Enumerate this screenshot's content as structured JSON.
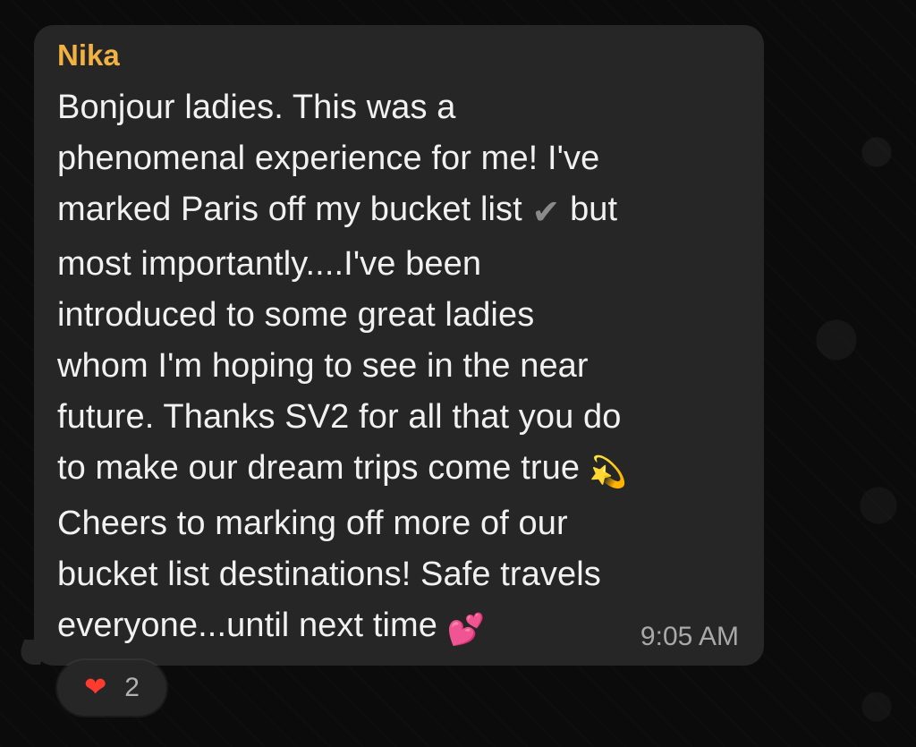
{
  "conversation": {
    "sender": "Nika",
    "message_lines": [
      "Bonjour ladies. This was a",
      "phenomenal experience for me! I've",
      "marked Paris off my bucket list ",
      "most importantly....I've been",
      "introduced to some great ladies",
      "whom I'm hoping to see in the near",
      "future. Thanks SV2 for all that you do",
      "to make our dream trips come true ",
      "Cheers to marking off more of our",
      "bucket list destinations! Safe travels",
      "everyone...until next time "
    ],
    "inline_texts": {
      "line_3_suffix": " but",
      "time": "9:05 AM"
    },
    "icons": {
      "checkmark": "checkmark-icon",
      "sparkle": "dizzy-sparkle-icon",
      "hearts": "pink-hearts-icon",
      "reaction": "red-heart-icon"
    },
    "reaction": {
      "count": "2"
    },
    "colors": {
      "background": "#0b0b0b",
      "bubble": "#262626",
      "sender": "#f2b143",
      "text": "#f1f1f1",
      "meta": "#a9a9a9"
    }
  }
}
